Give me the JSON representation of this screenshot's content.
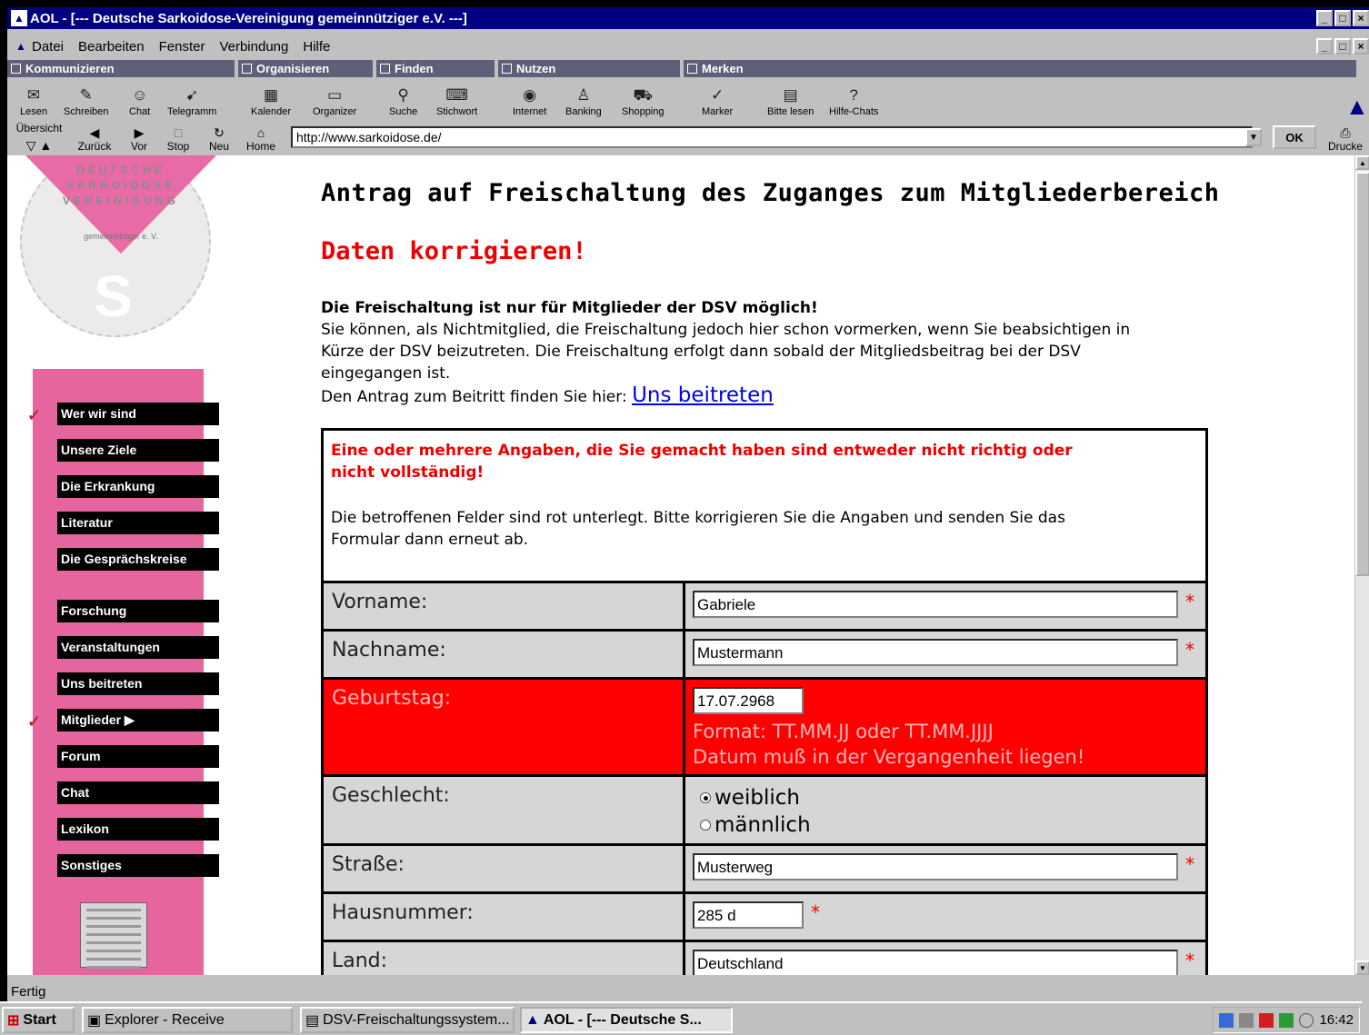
{
  "window": {
    "title": "AOL - [--- Deutsche Sarkoidose-Vereinigung gemeinnütziger e.V. ---]"
  },
  "menu": [
    "Datei",
    "Bearbeiten",
    "Fenster",
    "Verbindung",
    "Hilfe"
  ],
  "groups": {
    "kommunizieren": "Kommunizieren",
    "organisieren": "Organisieren",
    "finden": "Finden",
    "nutzen": "Nutzen",
    "merken": "Merken"
  },
  "toolbar": {
    "lesen": "Lesen",
    "schreiben": "Schreiben",
    "chat": "Chat",
    "telegramm": "Telegramm",
    "kalender": "Kalender",
    "organizer": "Organizer",
    "suche": "Suche",
    "stichwort": "Stichwort",
    "internet": "Internet",
    "banking": "Banking",
    "shopping": "Shopping",
    "marker": "Marker",
    "bitte_lesen": "Bitte lesen",
    "hilfe_chats": "Hilfe-Chats"
  },
  "nav": {
    "uebersicht": "Übersicht",
    "zurueck": "Zurück",
    "vor": "Vor",
    "stop": "Stop",
    "neu": "Neu",
    "home": "Home",
    "ok": "OK",
    "drucken": "Drucke"
  },
  "address": {
    "url": "http://www.sarkoidose.de/"
  },
  "logo": {
    "line1": "DEUTSCHE",
    "line2": "SARKOIDOSE",
    "line3": "VEREINIGUNG",
    "small": "gemeinnütziger e. V.",
    "letter": "S"
  },
  "sidebar": {
    "items": [
      "Wer wir sind",
      "Unsere Ziele",
      "Die Erkrankung",
      "Literatur",
      "Die Gesprächskreise",
      "Forschung",
      "Veranstaltungen",
      "Uns beitreten",
      "Mitglieder",
      "Forum",
      "Chat",
      "Lexikon",
      "Sonstiges"
    ]
  },
  "page": {
    "heading": "Antrag auf Freischaltung des Zuganges zum Mitgliederbereich",
    "subheading": "Daten korrigieren!",
    "intro_bold": "Die Freischaltung ist nur für Mitglieder der DSV möglich!",
    "intro_text": "Sie können, als Nichtmitglied, die Freischaltung jedoch hier schon vormerken, wenn Sie beabsichtigen in Kürze der DSV beizutreten. Die Freischaltung erfolgt dann sobald der Mitgliedsbeitrag bei der DSV eingegangen ist.",
    "intro_link_prefix": "Den Antrag zum Beitritt finden Sie hier:",
    "intro_link": "Uns beitreten"
  },
  "form": {
    "error_title": "Eine oder mehrere Angaben, die Sie gemacht haben sind entweder nicht richtig oder nicht vollständig!",
    "error_text": "Die betroffenen Felder sind rot unterlegt. Bitte korrigieren Sie die Angaben und senden Sie das Formular dann erneut ab.",
    "required_mark": "*",
    "vorname": {
      "label": "Vorname:",
      "value": "Gabriele"
    },
    "nachname": {
      "label": "Nachname:",
      "value": "Mustermann"
    },
    "geburtstag": {
      "label": "Geburtstag:",
      "value": "17.07.2968",
      "msg1": "Format: TT.MM.JJ oder TT.MM.JJJJ",
      "msg2": "Datum muß in der Vergangenheit liegen!"
    },
    "geschlecht": {
      "label": "Geschlecht:",
      "opt1": "weiblich",
      "opt2": "männlich",
      "selected": "weiblich"
    },
    "strasse": {
      "label": "Straße:",
      "value": "Musterweg"
    },
    "hausnummer": {
      "label": "Hausnummer:",
      "value": "285 d"
    },
    "land": {
      "label": "Land:",
      "value": "Deutschland"
    }
  },
  "status": "Fertig",
  "taskbar": {
    "start": "Start",
    "t1": "Explorer - Receive",
    "t2": "DSV-Freischaltungssystem...",
    "t3": "AOL - [--- Deutsche S...",
    "clock": "16:42"
  },
  "colors": {
    "titlebar": "#000080",
    "pink": "#e6659f",
    "error": "#ff0000",
    "link": "#0000ee"
  }
}
